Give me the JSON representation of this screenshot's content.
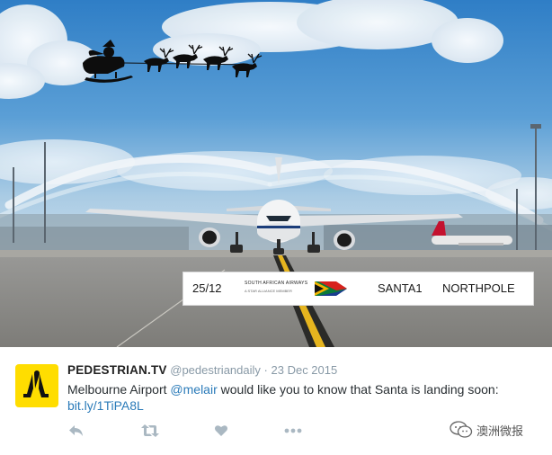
{
  "photo": {
    "board": {
      "date": "25/12",
      "airline": "SOUTH AFRICAN AIRWAYS",
      "airline_sub": "A STAR ALLIANCE MEMBER",
      "flight": "SANTA1",
      "destination": "NORTHPOLE"
    }
  },
  "tweet": {
    "display_name": "PEDESTRIAN.TV",
    "handle": "@pedestriandaily",
    "separator": "·",
    "date": "23 Dec 2015",
    "text_before": "Melbourne Airport ",
    "mention": "@melair",
    "text_after": " would like you to know that Santa is landing soon:",
    "link": "bit.ly/1TiPA8L"
  },
  "actions": {
    "icons": [
      "reply-icon",
      "retweet-icon",
      "like-icon",
      "more-icon"
    ]
  },
  "watermark": {
    "icon": "wechat-icon",
    "text": "澳洲微报"
  },
  "colors": {
    "avatar_bg": "#ffdd00",
    "link": "#2b7bb9",
    "meta": "#8899a6"
  }
}
